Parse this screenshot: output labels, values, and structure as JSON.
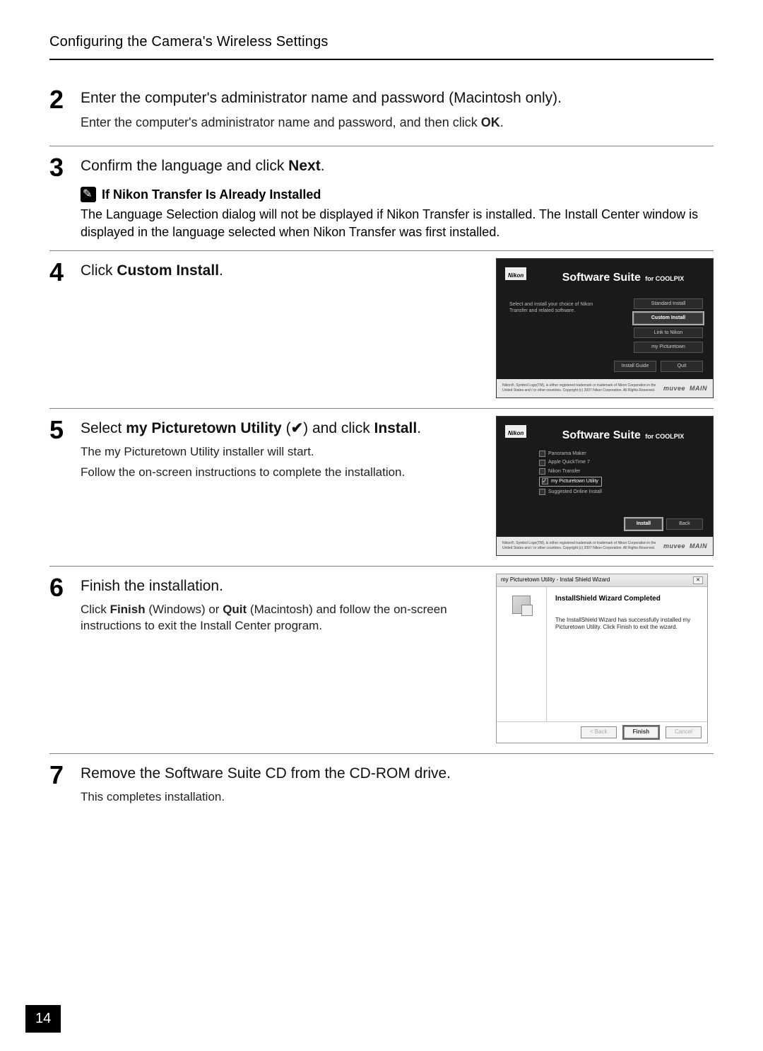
{
  "header": "Configuring the Camera's Wireless Settings",
  "step2": {
    "num": "2",
    "title_a": "Enter the computer's administrator name and password (Macintosh only).",
    "desc_a": "Enter the computer's administrator name and password, and then click ",
    "desc_b": "OK",
    "desc_c": "."
  },
  "step3": {
    "num": "3",
    "title_a": "Confirm the language and click ",
    "title_b": "Next",
    "title_c": ".",
    "note_title": "If Nikon Transfer Is Already Installed",
    "note_body": "The Language Selection dialog will not be displayed if Nikon Transfer is installed. The Install Center window is displayed in the language selected when Nikon Transfer was first installed."
  },
  "step4": {
    "num": "4",
    "title_a": "Click ",
    "title_b": "Custom Install",
    "title_c": "."
  },
  "step5": {
    "num": "5",
    "title_a": "Select ",
    "title_b": "my Picturetown Utility",
    "title_c": " (",
    "checkmark": "✔",
    "title_d": ") and click ",
    "title_e": "Install",
    "title_f": ".",
    "desc1": "The my Picturetown Utility installer will start.",
    "desc2": "Follow the on-screen instructions to complete the installation."
  },
  "step6": {
    "num": "6",
    "title": "Finish the installation.",
    "desc_a": "Click ",
    "desc_b": "Finish",
    "desc_c": " (Windows) or ",
    "desc_d": "Quit",
    "desc_e": " (Macintosh) and follow the on-screen instructions to exit the Install Center program."
  },
  "step7": {
    "num": "7",
    "title": "Remove the Software Suite CD from the CD-ROM drive.",
    "desc": "This completes installation."
  },
  "suite1": {
    "logo": "Nikon",
    "title_main": "Software Suite ",
    "title_sub": "for COOLPIX",
    "instruction": "Select and install your choice of Nikon Transfer and related software.",
    "btns": [
      "Standard Install",
      "Custom Install",
      "Link to Nikon",
      "my Picturetown"
    ],
    "bottom": [
      "Install Guide",
      "Quit"
    ],
    "copyright": "Nikon®, Symbol Logo(TM), is either registered trademark or trademark of Nikon Corporation in the United States and / or other countries. Copyright (c) 2007 Nikon Corporation. All Rights Reserved.",
    "brand1": "muvee",
    "brand2": "MAIN"
  },
  "suite2": {
    "logo": "Nikon",
    "title_main": "Software Suite ",
    "title_sub": "for COOLPIX",
    "items": [
      "Panorama Maker",
      "Apple QuickTime 7",
      "Nikon Transfer",
      "my Picturetown Utility",
      "Suggested Online Install"
    ],
    "bottom": [
      "Install",
      "Back"
    ],
    "copyright": "Nikon®, Symbol Logo(TM), is either registered trademark or trademark of Nikon Corporation in the United States and / or other countries. Copyright (c) 2007 Nikon Corporation. All Rights Reserved.",
    "brand1": "muvee",
    "brand2": "MAIN"
  },
  "wizard": {
    "title": "my Picturetown Utility - Instal Shield Wizard",
    "close": "✕",
    "heading": "InstallShield Wizard Completed",
    "body": "The InstallShield Wizard has successfully installed my Picturetown Utility. Click Finish to exit the wizard.",
    "back": "< Back",
    "finish": "Finish",
    "cancel": "Cancel"
  },
  "page_number": "14"
}
